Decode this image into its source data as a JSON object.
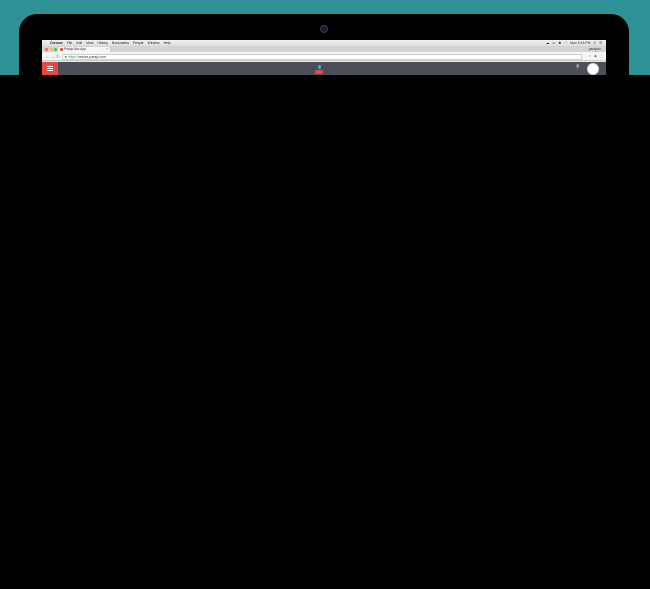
{
  "menubar": {
    "items": [
      "Chrome",
      "File",
      "Edit",
      "View",
      "History",
      "Bookmarks",
      "People",
      "Window",
      "Help"
    ],
    "clock": "Mon 9:13 PM"
  },
  "tab": {
    "title": "Parajo Ako App",
    "close_glyph": "×"
  },
  "profile": {
    "name": "parajoco"
  },
  "address": {
    "scheme": "https://",
    "host": "secure.parajo.com"
  },
  "colors": {
    "desktop_teal": "#2e9196",
    "accent_red": "#e8493f",
    "header_dark": "#4a4f5a",
    "logo_blue": "#3aaee0"
  }
}
